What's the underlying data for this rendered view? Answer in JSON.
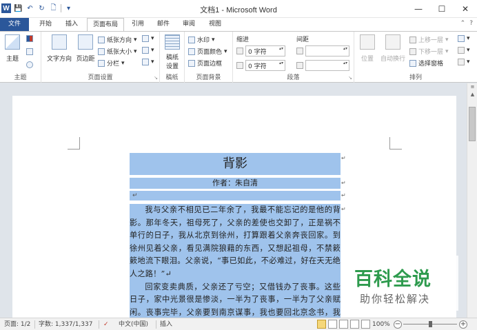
{
  "window": {
    "title": "文档1 - Microsoft Word",
    "minimize": "—",
    "maximize": "☐",
    "close": "✕"
  },
  "quick_access": {
    "logo": "W",
    "items": [
      "save-icon",
      "undo-icon",
      "redo-icon",
      "new-document-icon",
      "customize-qat-icon"
    ]
  },
  "tabs": [
    {
      "label": "文件"
    },
    {
      "label": "开始"
    },
    {
      "label": "插入"
    },
    {
      "label": "页面布局"
    },
    {
      "label": "引用"
    },
    {
      "label": "邮件"
    },
    {
      "label": "审阅"
    },
    {
      "label": "视图"
    }
  ],
  "tabbar_right": {
    "collapse": "⌃",
    "help": "?"
  },
  "ribbon": {
    "theme": {
      "themes_label": "主题",
      "group_label": "主题"
    },
    "page_setup": {
      "text_direction": "文字方向",
      "margins": "页边距",
      "orientation": "纸张方向",
      "size": "纸张大小",
      "columns": "分栏",
      "group_label": "页面设置"
    },
    "manuscript": {
      "label_line1": "稿纸",
      "label_line2": "设置",
      "group_label": "稿纸"
    },
    "page_background": {
      "watermark": "水印",
      "page_color": "页面颜色",
      "page_borders": "页面边框",
      "group_label": "页面背景"
    },
    "paragraph": {
      "indent_label": "缩进",
      "spacing_label": "间距",
      "indent_left": "0 字符",
      "indent_right": "0 字符",
      "spacing_before": "",
      "spacing_after": "",
      "group_label": "段落"
    },
    "arrange": {
      "position": "位置",
      "wrap_text": "自动换行",
      "bring_forward": "上移一层",
      "send_backward": "下移一层",
      "selection_pane": "选择窗格",
      "group_label": "排列"
    }
  },
  "document": {
    "title": "背影",
    "author": "作者：朱自清",
    "paragraph_mark": "↵",
    "body": [
      "我与父亲不相见已二年余了，我最不能忘记的是他的背影。那年冬天，祖母死了，父亲的差使也交卸了，正是祸不单行的日子，我从北京到徐州，打算跟着父亲奔丧回家。到徐州见着父亲，看见满院狼藉的东西，又想起祖母，不禁簌簌地流下眼泪。父亲说，“事已如此，不必难过，好在天无绝人之路！”↵",
      "回家变卖典质，父亲还了亏空；又借钱办了丧事。这些日子，家中光景很是惨淡，一半为了丧事，一半为了父亲赋闲。丧事完毕，父亲要到南京谋事，我也要回北京念书，我们便同行。↵"
    ]
  },
  "watermark_brand": {
    "main": "百科全说",
    "sub": "助你轻松解决"
  },
  "statusbar": {
    "page": "页面: 1/2",
    "words": "字数: 1,337/1,337",
    "language": "中文(中国)",
    "mode": "插入",
    "zoom": "100%",
    "zoom_level_percent": 100
  }
}
